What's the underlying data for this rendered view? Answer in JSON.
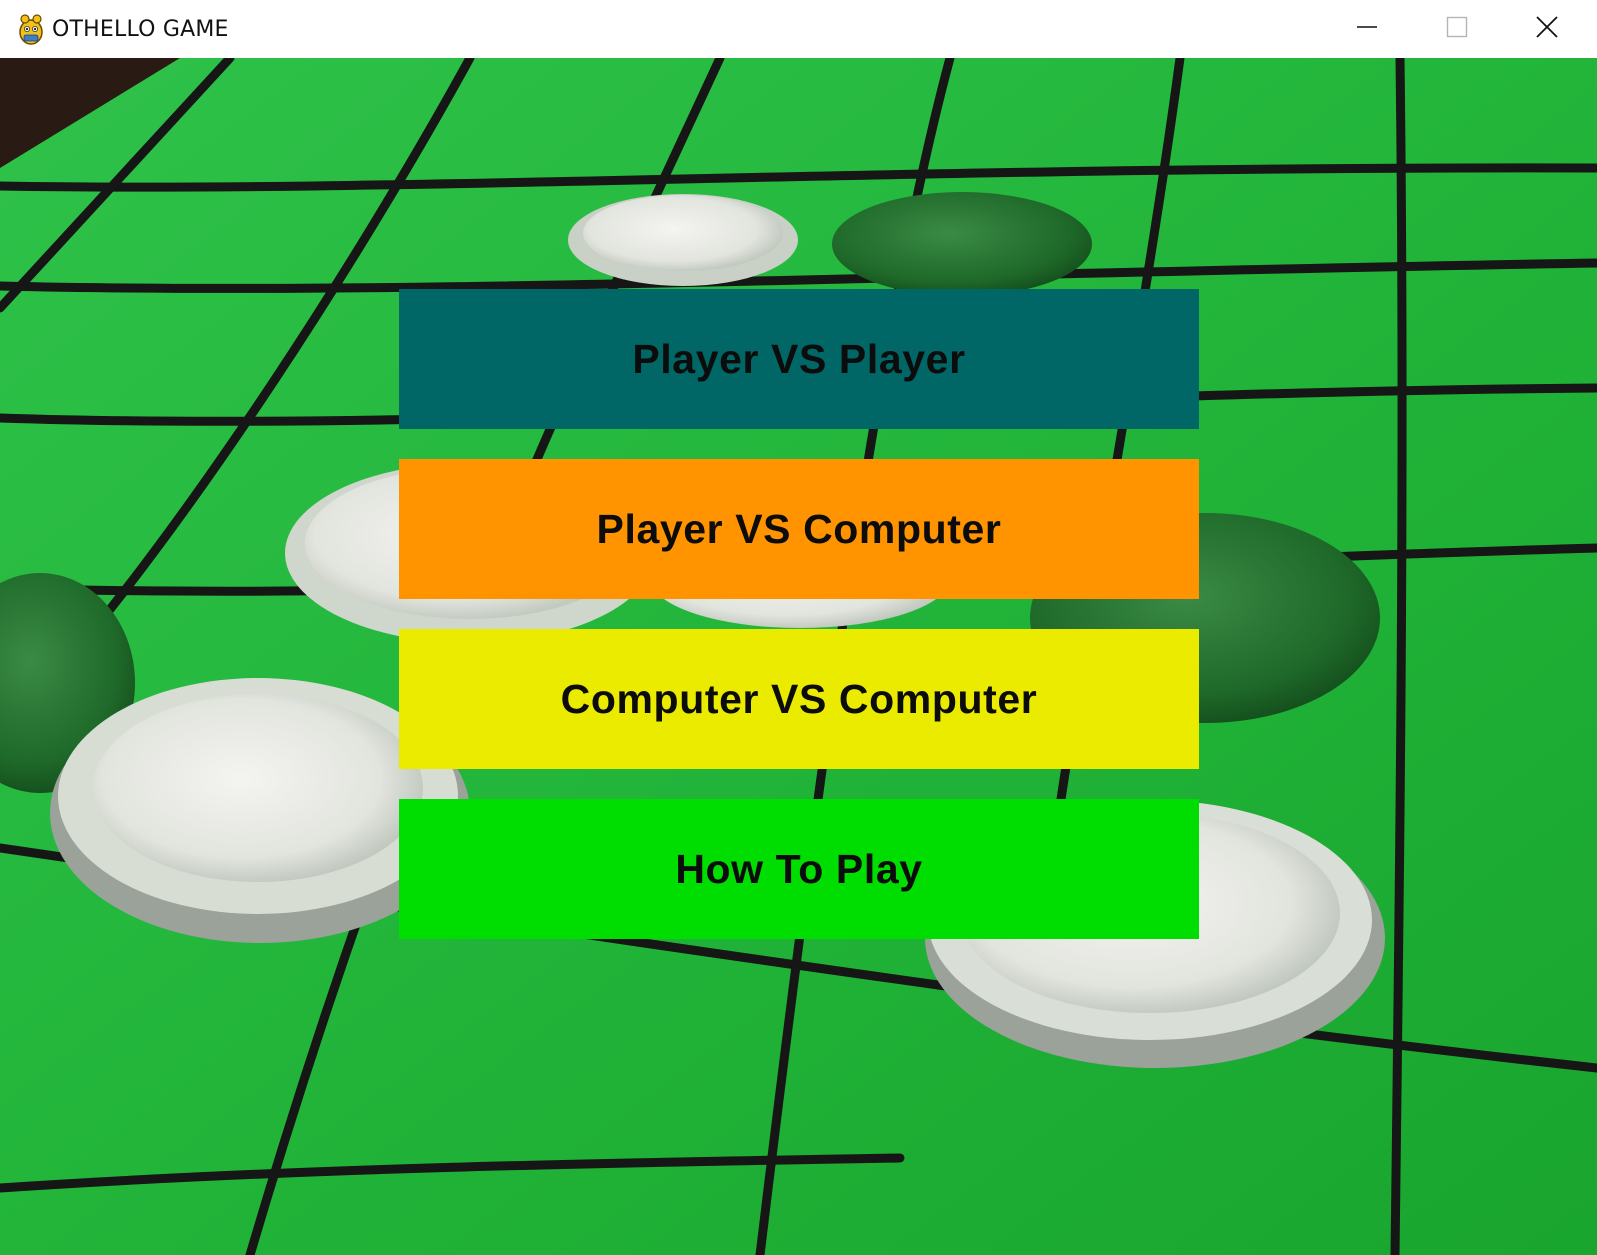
{
  "window": {
    "title": "OTHELLO GAME",
    "icon": "pygame-snake-icon",
    "controls": {
      "minimize_icon": "minimize-icon",
      "maximize_icon": "maximize-icon",
      "close_icon": "close-icon"
    }
  },
  "background": {
    "description_icon": "othello-board-photo",
    "board_color": "#22b53a",
    "grid_line_color": "#1a1a1a"
  },
  "menu": {
    "buttons": [
      {
        "label": "Player VS Player",
        "color": "#006666"
      },
      {
        "label": "Player VS Computer",
        "color": "#ff9400"
      },
      {
        "label": "Computer VS Computer",
        "color": "#ebeb00"
      },
      {
        "label": "How To Play",
        "color": "#00dd00"
      }
    ]
  }
}
